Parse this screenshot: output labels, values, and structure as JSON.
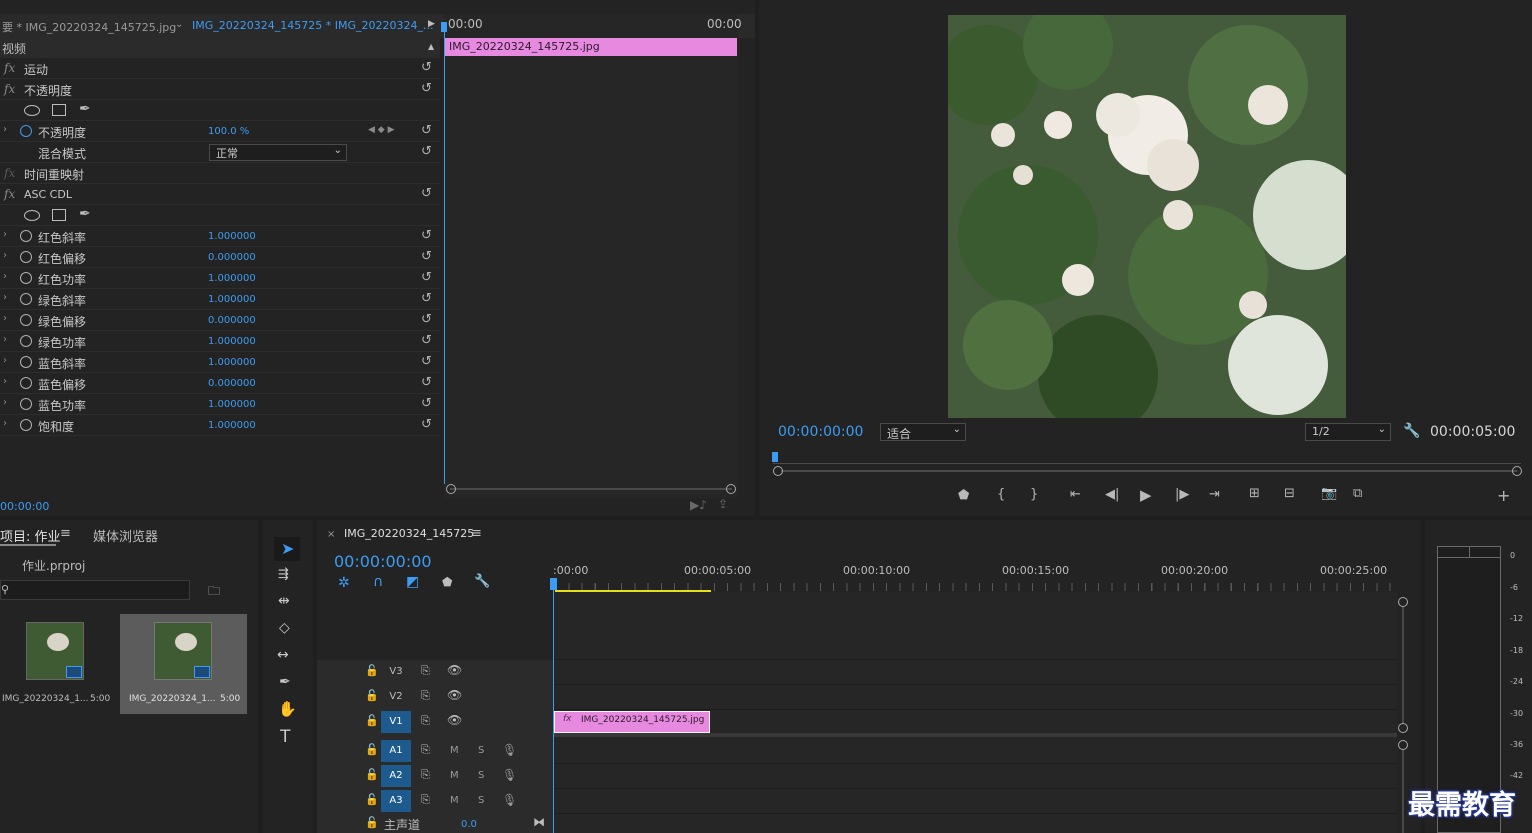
{
  "effect_controls": {
    "tab1": "要 * IMG_20220324_145725.jpg",
    "tab2": "IMG_20220324_145725 * IMG_20220324_...",
    "section": "视频",
    "mini_time_start": "00:00",
    "mini_time_end": "00:00",
    "clip_label": "IMG_20220324_145725.jpg",
    "time": "00:00:00",
    "rows": [
      {
        "label": "运动",
        "type": "fx"
      },
      {
        "label": "不透明度",
        "type": "fx"
      },
      {
        "label": "不透明度",
        "value": "100.0 %",
        "type": "param"
      },
      {
        "label": "混合模式",
        "value": "正常",
        "type": "select"
      },
      {
        "label": "时间重映射",
        "type": "fx"
      },
      {
        "label": "ASC CDL",
        "type": "fx"
      },
      {
        "label": "红色斜率",
        "value": "1.000000",
        "type": "param"
      },
      {
        "label": "红色偏移",
        "value": "0.000000",
        "type": "param"
      },
      {
        "label": "红色功率",
        "value": "1.000000",
        "type": "param"
      },
      {
        "label": "绿色斜率",
        "value": "1.000000",
        "type": "param"
      },
      {
        "label": "绿色偏移",
        "value": "0.000000",
        "type": "param"
      },
      {
        "label": "绿色功率",
        "value": "1.000000",
        "type": "param"
      },
      {
        "label": "蓝色斜率",
        "value": "1.000000",
        "type": "param"
      },
      {
        "label": "蓝色偏移",
        "value": "0.000000",
        "type": "param"
      },
      {
        "label": "蓝色功率",
        "value": "1.000000",
        "type": "param"
      },
      {
        "label": "饱和度",
        "value": "1.000000",
        "type": "param"
      }
    ]
  },
  "program_monitor": {
    "current_time": "00:00:00:00",
    "zoom": "适合",
    "resolution": "1/2",
    "duration": "00:00:05:00"
  },
  "project": {
    "tab1": "项目: 作业",
    "tab2": "媒体浏览器",
    "file": "作业.prproj",
    "items": [
      {
        "name": "IMG_20220324_1...",
        "duration": "5:00"
      },
      {
        "name": "IMG_20220324_1...",
        "duration": "5:00"
      }
    ]
  },
  "timeline": {
    "sequence": "IMG_20220324_145725",
    "current_time": "00:00:00:00",
    "ruler": [
      ":00:00",
      "00:00:05:00",
      "00:00:10:00",
      "00:00:15:00",
      "00:00:20:00",
      "00:00:25:00"
    ],
    "tracks": [
      "V3",
      "V2",
      "V1",
      "A1",
      "A2",
      "A3"
    ],
    "master": "主声道",
    "master_value": "0.0",
    "clip": "IMG_20220324_145725.jpg"
  },
  "meter": {
    "ticks": [
      "0",
      "-6",
      "-12",
      "-18",
      "-24",
      "-30",
      "-36",
      "-42"
    ]
  },
  "watermark": "最需教育",
  "colors": {
    "accent": "#3d9cf2",
    "clip": "#e889e0",
    "bg": "#232323"
  }
}
